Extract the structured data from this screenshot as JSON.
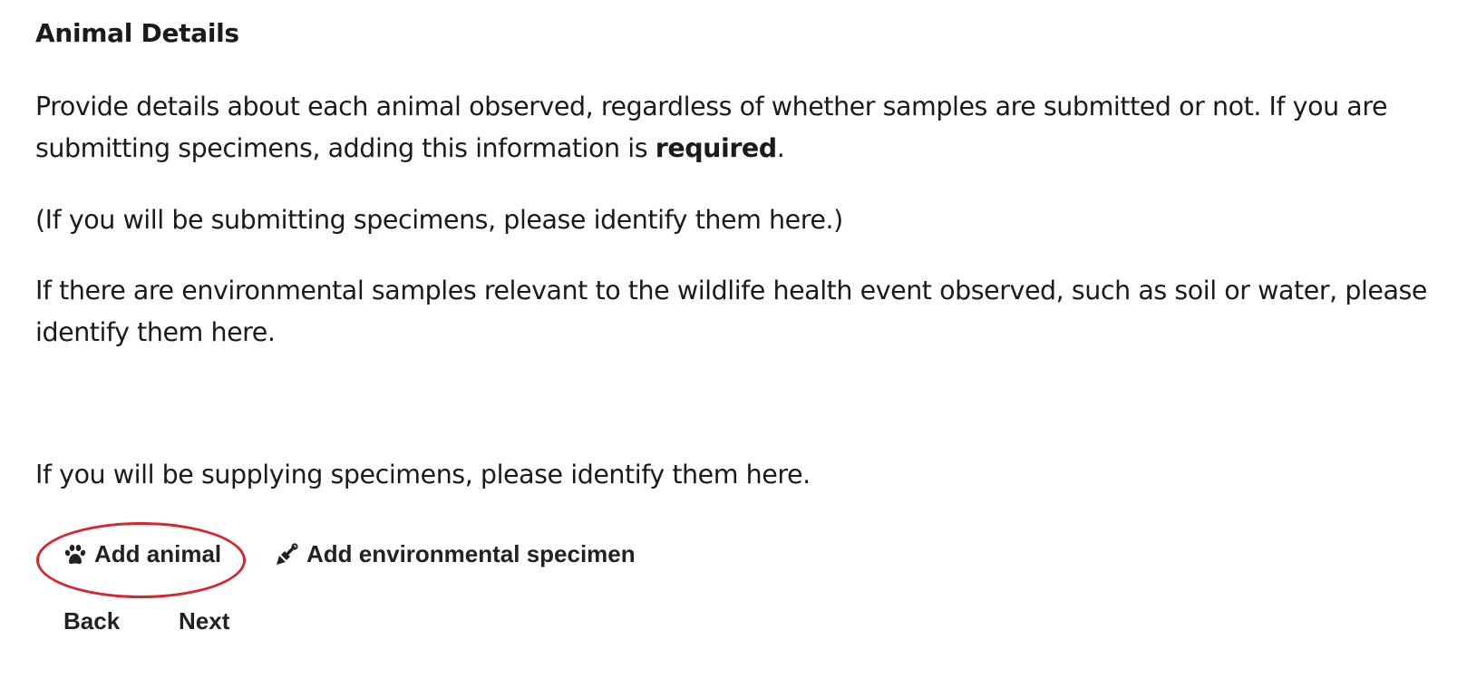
{
  "section": {
    "title": "Animal Details"
  },
  "intro": {
    "text_before": "Provide details about each animal observed, regardless of whether samples are submitted or not. If you are submitting specimens, adding this information is ",
    "emphasis": "required",
    "text_after": "."
  },
  "note_submitting": "(If you will be submitting specimens, please identify them here.)",
  "note_environmental": "If there are environmental samples relevant to the wildlife health event observed, such as soil or water, please identify them here.",
  "note_supplying": "If you will be supplying specimens, please identify them here.",
  "actions": {
    "add_animal": {
      "label": "Add animal",
      "icon": "paw-icon"
    },
    "add_environmental": {
      "label": "Add environmental specimen",
      "icon": "trowel-icon"
    }
  },
  "navigation": {
    "back_label": "Back",
    "next_label": "Next"
  },
  "colors": {
    "text": "#1b1b1b",
    "highlight": "#d7262e"
  }
}
